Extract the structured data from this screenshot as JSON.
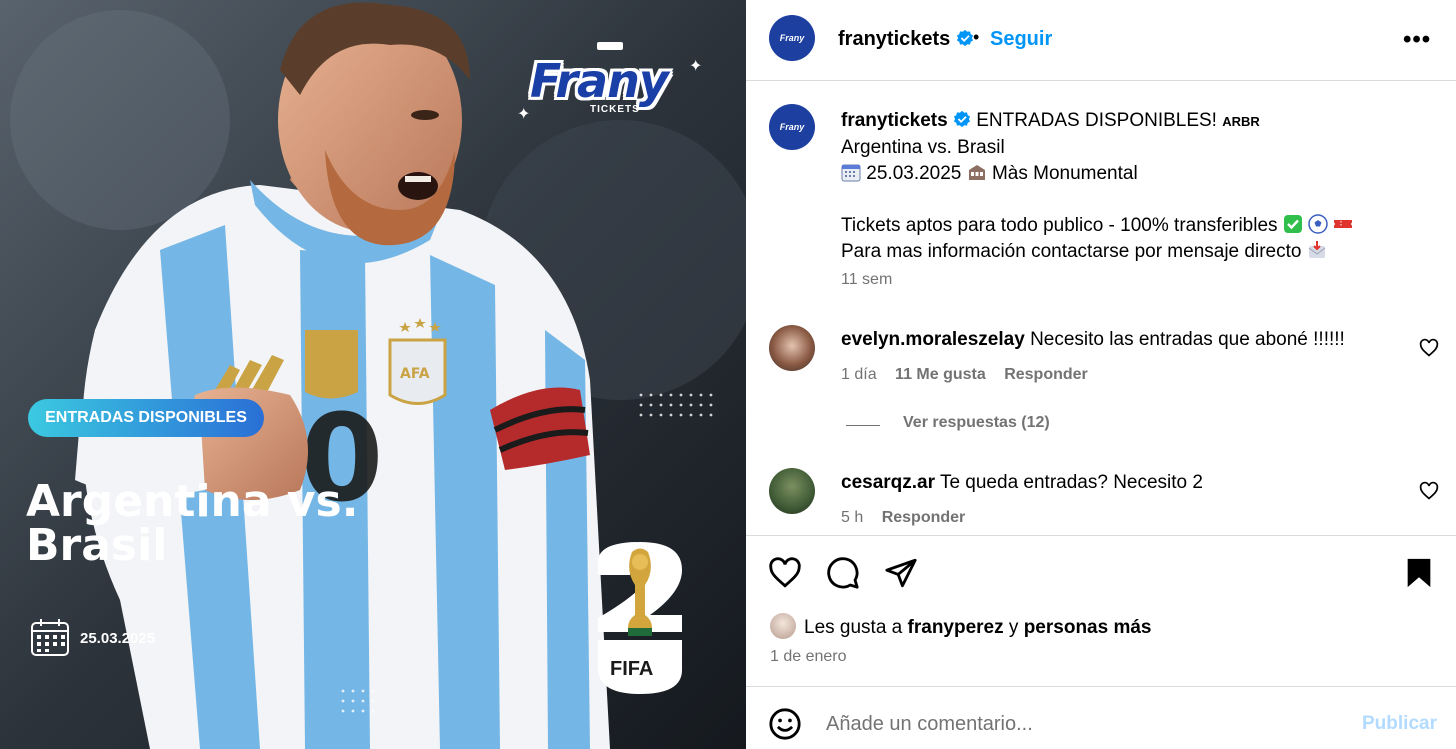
{
  "media": {
    "brand_name": "Frany",
    "brand_sub": "TICKETS",
    "pill": "ENTRADAS DISPONIBLES",
    "title_line1": "Argentina vs.",
    "title_line2": "Brasil",
    "date": "25.03.2025",
    "fifa": "FIFA"
  },
  "header": {
    "username": "franytickets",
    "dot": "•",
    "follow": "Seguir",
    "more": "•••"
  },
  "caption": {
    "username": "franytickets",
    "headline": "ENTRADAS DISPONIBLES!",
    "flags": "ARBR",
    "line2": "Argentina vs. Brasil",
    "date": "25.03.2025",
    "venue": "Màs Monumental",
    "line4": "Tickets aptos para todo publico - 100% transferibles",
    "line5": "Para mas información contactarse por mensaje directo",
    "time": "11 sem"
  },
  "comments": [
    {
      "username": "evelyn.moraleszelay",
      "text": "Necesito las entradas que aboné !!!!!!",
      "time": "1 día",
      "likes": "11 Me gusta",
      "reply": "Responder"
    },
    {
      "username": "cesarqz.ar",
      "text": "Te queda entradas? Necesito 2",
      "time": "5 h",
      "reply": "Responder"
    }
  ],
  "view_replies": "Ver respuestas (12)",
  "likes": {
    "prefix": "Les gusta a",
    "user": "franyperez",
    "mid": "y",
    "rest": "personas más"
  },
  "post_date": "1 de enero",
  "comment_box": {
    "placeholder": "Añade un comentario...",
    "publish": "Publicar"
  },
  "colors": {
    "accent": "#0095f6",
    "brand_blue": "#1c3fa0",
    "muted": "#737373",
    "publish_disabled": "#b3dbff"
  }
}
